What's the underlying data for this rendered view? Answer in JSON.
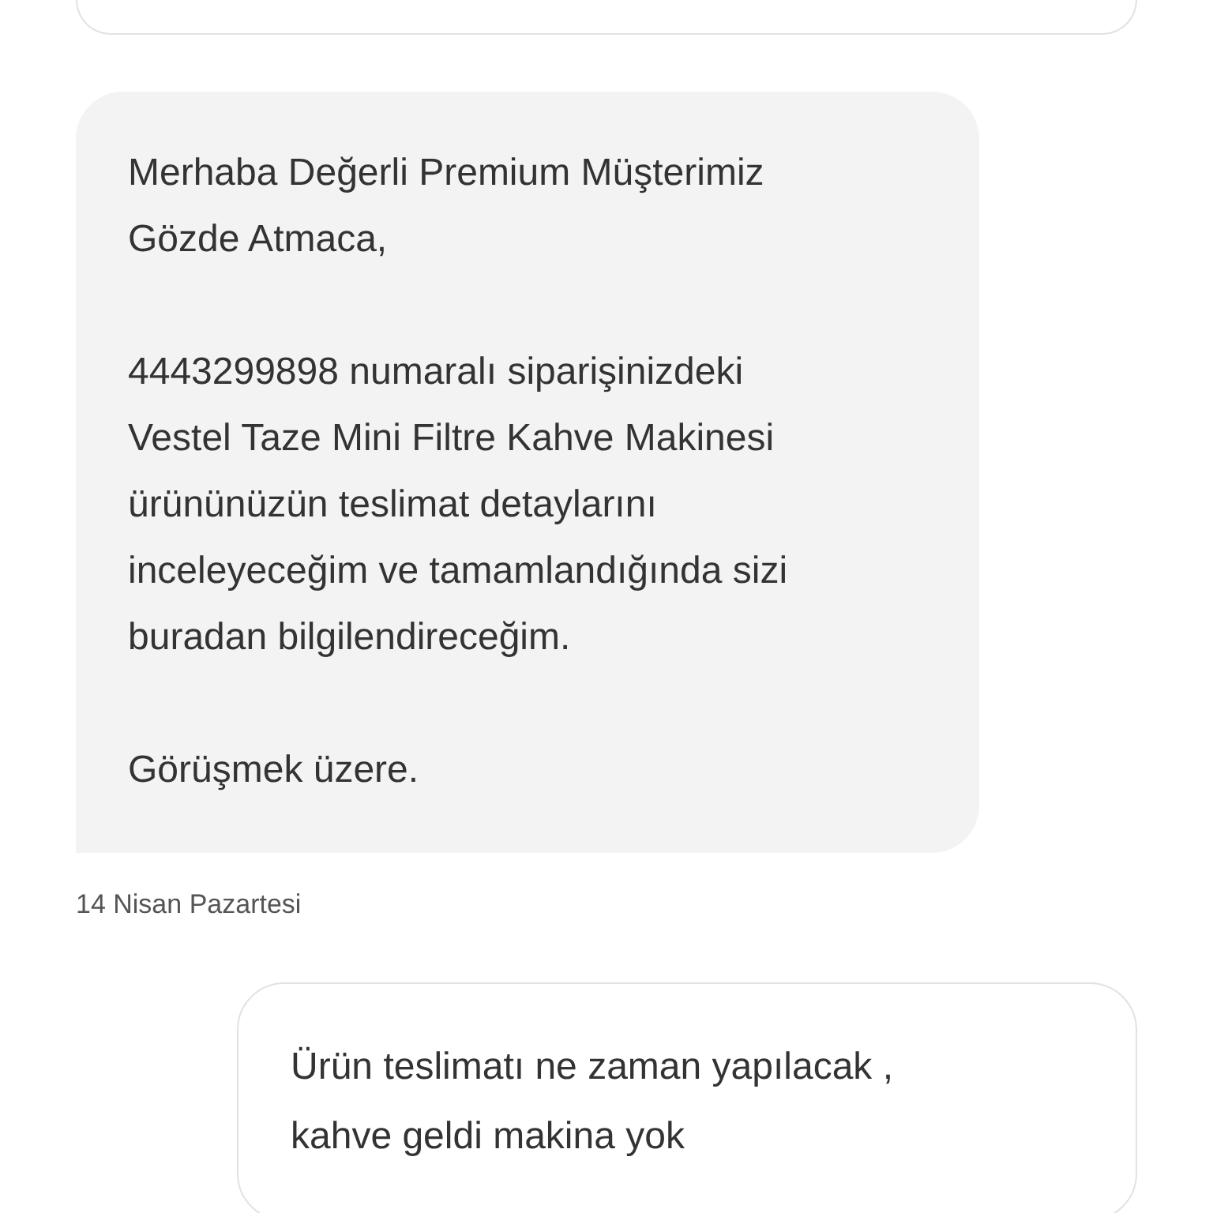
{
  "messages": [
    {
      "kind": "outgoing_cut"
    },
    {
      "kind": "incoming",
      "paragraphs": [
        {
          "lines": [
            "Merhaba Değerli Premium Müşterimiz",
            "Gözde Atmaca,"
          ]
        },
        {
          "lines": [
            "4443299898 numaralı siparişinizdeki",
            "Vestel Taze Mini Filtre Kahve Makinesi",
            "ürününüzün teslimat detaylarını",
            "inceleyeceğim ve tamamlandığında sizi",
            "buradan bilgilendireceğim."
          ]
        },
        {
          "lines": [
            "Görüşmek üzere."
          ]
        }
      ]
    },
    {
      "kind": "date",
      "text": "14 Nisan Pazartesi"
    },
    {
      "kind": "outgoing",
      "paragraphs": [
        {
          "lines": [
            "Ürün teslimatı ne zaman yapılacak ,",
            "kahve geldi makina yok"
          ]
        }
      ]
    }
  ]
}
